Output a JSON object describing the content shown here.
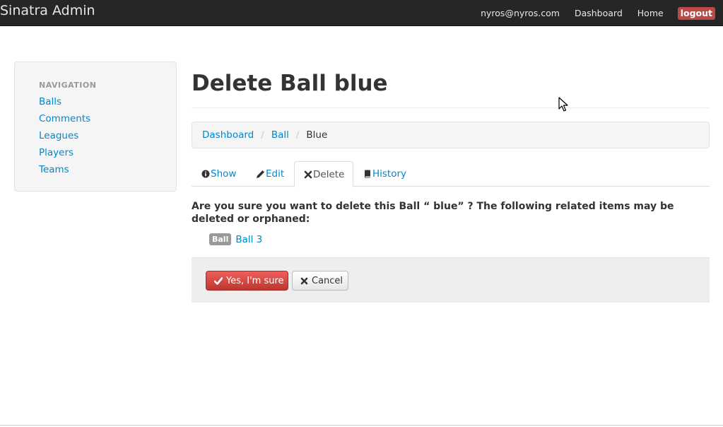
{
  "navbar": {
    "brand": "Sinatra Admin",
    "user_email": "nyros@nyros.com",
    "dashboard_label": "Dashboard",
    "home_label": "Home",
    "logout_label": "logout"
  },
  "sidebar": {
    "header": "NAVIGATION",
    "items": [
      {
        "label": "Balls"
      },
      {
        "label": "Comments"
      },
      {
        "label": "Leagues"
      },
      {
        "label": "Players"
      },
      {
        "label": "Teams"
      }
    ]
  },
  "main": {
    "title": "Delete Ball blue",
    "breadcrumb": [
      {
        "label": "Dashboard"
      },
      {
        "label": "Ball"
      },
      {
        "label": "Blue"
      }
    ],
    "breadcrumb_separator": "/",
    "tabs": [
      {
        "label": "Show",
        "icon": "info-icon"
      },
      {
        "label": "Edit",
        "icon": "pencil-icon"
      },
      {
        "label": "Delete",
        "icon": "close-icon"
      },
      {
        "label": "History",
        "icon": "book-icon"
      }
    ],
    "active_tab": "Delete",
    "confirm_text": "Are you sure you want to delete this Ball “ blue” ? The following related items may be deleted or orphaned:",
    "related_items": [
      {
        "badge": "Ball",
        "label": "Ball 3"
      }
    ],
    "actions": {
      "confirm_label": "Yes, I'm sure",
      "cancel_label": "Cancel"
    }
  },
  "colors": {
    "navbar_bg": "#262626",
    "link": "#0088cc",
    "danger": "#da4f49",
    "logout_bg": "#b94a48"
  }
}
